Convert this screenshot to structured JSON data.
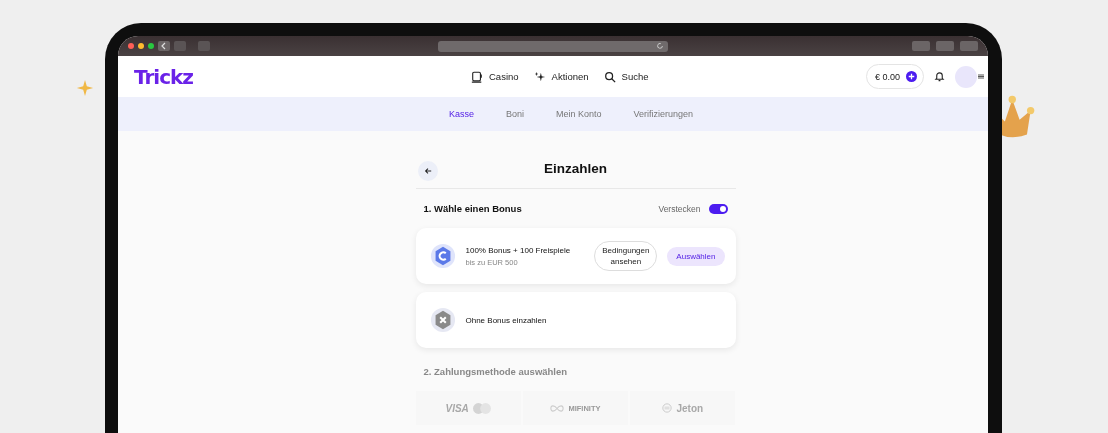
{
  "header": {
    "logo": "Trickz",
    "nav": [
      {
        "label": "Casino"
      },
      {
        "label": "Aktionen"
      },
      {
        "label": "Suche"
      }
    ],
    "balance": "€ 0.00"
  },
  "tabs": [
    {
      "label": "Kasse",
      "selected": true
    },
    {
      "label": "Boni",
      "selected": false
    },
    {
      "label": "Mein Konto",
      "selected": false
    },
    {
      "label": "Verifizierungen",
      "selected": false
    }
  ],
  "page": {
    "title": "Einzahlen",
    "section_1": "1. Wähle einen Bonus",
    "toggle": {
      "label": "Verstecken",
      "on": true
    },
    "section_2": "2. Zahlungsmethode auswählen"
  },
  "bonuses": [
    {
      "kind": "offer",
      "title": "100% Bonus + 100 Freispiele",
      "subtitle": "bis zu EUR 500",
      "terms_button": "Bedingungen ansehen",
      "select_button": "Auswählen"
    },
    {
      "kind": "none",
      "title": "Ohne Bonus einzahlen"
    }
  ],
  "payment_methods": [
    {
      "label": "VISA"
    },
    {
      "label": "MIFINITY"
    },
    {
      "label": "Jeton"
    }
  ]
}
